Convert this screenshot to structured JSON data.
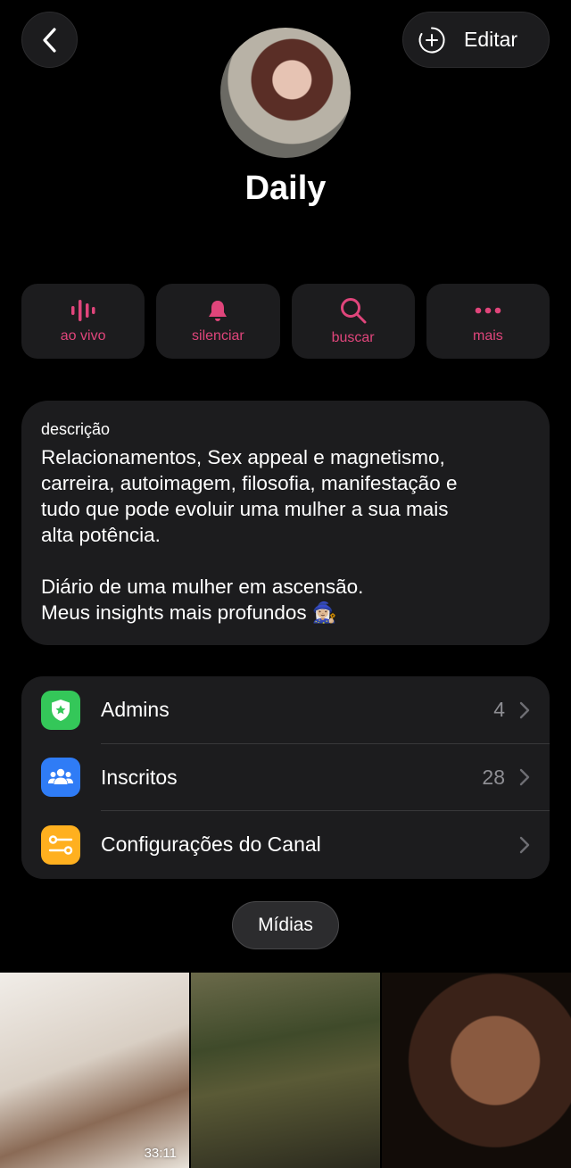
{
  "header": {
    "back_icon": "chevron-left-icon",
    "edit_icon": "add-circle-icon",
    "edit_label": "Editar"
  },
  "channel": {
    "name": "Daily"
  },
  "actions": [
    {
      "label": "ao vivo",
      "icon": "waveform-icon"
    },
    {
      "label": "silenciar",
      "icon": "bell-icon"
    },
    {
      "label": "buscar",
      "icon": "search-icon"
    },
    {
      "label": "mais",
      "icon": "more-icon"
    }
  ],
  "description": {
    "title": "descrição",
    "text": "Relacionamentos, Sex appeal e magnetismo,\ncarreira, autoimagem, filosofia, manifestação e\ntudo que pode evoluir uma mulher a sua mais\nalta potência.\n\nDiário de uma mulher em ascensão.\nMeus insights mais profundos 🧙🏼‍♀️"
  },
  "info_list": [
    {
      "label": "Admins",
      "count": "4",
      "icon": "shield-star-icon",
      "color": "#34c759"
    },
    {
      "label": "Inscritos",
      "count": "28",
      "icon": "people-icon",
      "color": "#2f7cf6"
    },
    {
      "label": "Configurações do Canal",
      "count": "",
      "icon": "sliders-icon",
      "color": "#ffb01f"
    }
  ],
  "media": {
    "tab_label": "Mídias",
    "items": [
      {
        "duration": "33:11"
      },
      {
        "duration": ""
      },
      {
        "duration": ""
      }
    ]
  },
  "colors": {
    "accent": "#e0457b",
    "card": "#1c1c1e",
    "secondary_text": "#8e8e93"
  }
}
